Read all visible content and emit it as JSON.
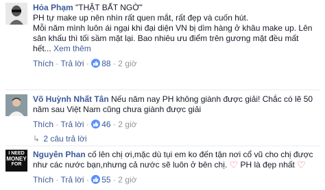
{
  "comments": [
    {
      "author": "Hỏa Phạm",
      "quote": "\"THẬT BẤT NGỜ\"",
      "line1": "PH tự make up nên nhìn rất quen mắt, rất đẹp và cuốn hút.",
      "line2": "Mỗi năm mình luôn ái ngại khi đại diện VN bị dìm hàng ở khâu make up. Lên",
      "line3": "sân khấu thì tối sầm mặt lại. Bao nhiêu ưu điểm trên gương mặt đều mất",
      "line4_prefix": "hết...",
      "see_more": "Xem thêm",
      "like_label": "Thích",
      "reply_label": "Trả lời",
      "like_count": "88",
      "time": "2 giờ"
    },
    {
      "author": "Võ Huỳnh Nhất Tân",
      "line1": "Nếu năm nay PH không giành được giải! Chắc có lẽ 50",
      "line2": "năm sau Việt Nam cũng chưa giành được giải",
      "like_label": "Thích",
      "reply_label": "Trả lời",
      "like_count": "46",
      "time": "2 giờ",
      "replies_label": "2 câu trả lời"
    },
    {
      "author": "Nguyên Phan",
      "line1": "cố lên chị ơi,mặc dù tụi em ko đến tận nơi cổ vũ cho chị được",
      "line2": "như các nước bạn,nhưng cả nước sẽ luôn ở bên chị.",
      "line2_suffix": "PH là đẹp nhất",
      "like_label": "Thích",
      "reply_label": "Trả lời",
      "like_count": "55",
      "time": "2 giờ",
      "avatar_text": [
        "I NEED",
        "MONEY",
        "FOR"
      ]
    }
  ],
  "colors": {
    "link": "#3b5998",
    "meta": "#90949c",
    "like_badge": "#5890ff",
    "heart": "#e9556e"
  }
}
